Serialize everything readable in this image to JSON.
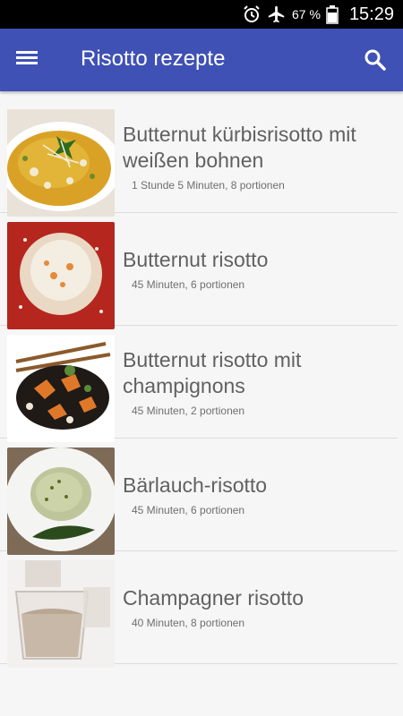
{
  "status_bar": {
    "battery_percent": "67 %",
    "time": "15:29",
    "icons": [
      "alarm-icon",
      "airplane-icon",
      "battery-icon"
    ]
  },
  "app_bar": {
    "title": "Risotto rezepte",
    "menu_icon": "menu-icon",
    "search_icon": "search-icon",
    "background": "#3f51b5"
  },
  "recipes": [
    {
      "title": "Butternut kürbisrisotto mit weißen bohnen",
      "meta": "1 Stunde 5 Minuten, 8 portionen"
    },
    {
      "title": "Butternut risotto",
      "meta": "45 Minuten, 6 portionen"
    },
    {
      "title": "Butternut risotto mit champignons",
      "meta": "45 Minuten, 2 portionen"
    },
    {
      "title": "Bärlauch-risotto",
      "meta": "45 Minuten, 6 portionen"
    },
    {
      "title": "Champagner risotto",
      "meta": "40 Minuten, 8 portionen"
    }
  ]
}
